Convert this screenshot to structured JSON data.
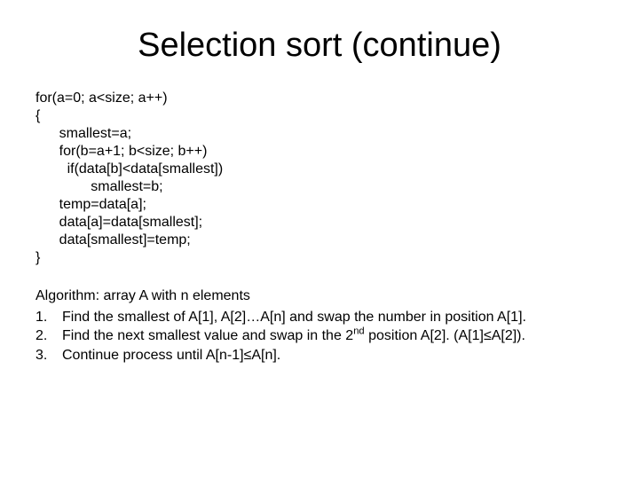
{
  "title": "Selection sort (continue)",
  "code": "for(a=0; a<size; a++)\n{\n      smallest=a;\n      for(b=a+1; b<size; b++)\n        if(data[b]<data[smallest])\n              smallest=b;\n      temp=data[a];\n      data[a]=data[smallest];\n      data[smallest]=temp;\n}",
  "algorithm": {
    "header": "Algorithm: array A with n elements",
    "items": [
      {
        "num": "1.",
        "text": "Find the smallest of A[1], A[2]…A[n] and swap the number in position A[1]."
      },
      {
        "num": "2.",
        "text_html": "Find the next smallest value and swap in the 2<sup>nd</sup> position A[2]. (A[1]≤A[2])."
      },
      {
        "num": "3.",
        "text": "Continue process until A[n-1]≤A[n]."
      }
    ]
  }
}
